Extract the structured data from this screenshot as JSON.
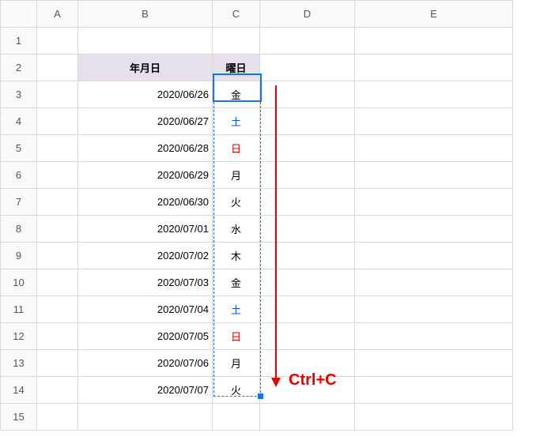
{
  "columns": [
    "A",
    "B",
    "C",
    "D",
    "E"
  ],
  "rowNumbers": [
    "1",
    "2",
    "3",
    "4",
    "5",
    "6",
    "7",
    "8",
    "9",
    "10",
    "11",
    "12",
    "13",
    "14",
    "15"
  ],
  "headers": {
    "B2": "年月日",
    "C2": "曜日"
  },
  "rows": [
    {
      "date": "2020/06/26",
      "day": "金",
      "color": "black"
    },
    {
      "date": "2020/06/27",
      "day": "土",
      "color": "blue"
    },
    {
      "date": "2020/06/28",
      "day": "日",
      "color": "red"
    },
    {
      "date": "2020/06/29",
      "day": "月",
      "color": "black"
    },
    {
      "date": "2020/06/30",
      "day": "火",
      "color": "black"
    },
    {
      "date": "2020/07/01",
      "day": "水",
      "color": "black"
    },
    {
      "date": "2020/07/02",
      "day": "木",
      "color": "black"
    },
    {
      "date": "2020/07/03",
      "day": "金",
      "color": "black"
    },
    {
      "date": "2020/07/04",
      "day": "土",
      "color": "blue"
    },
    {
      "date": "2020/07/05",
      "day": "日",
      "color": "red"
    },
    {
      "date": "2020/07/06",
      "day": "月",
      "color": "black"
    },
    {
      "date": "2020/07/07",
      "day": "火",
      "color": "black"
    }
  ],
  "annotation": "Ctrl+C"
}
